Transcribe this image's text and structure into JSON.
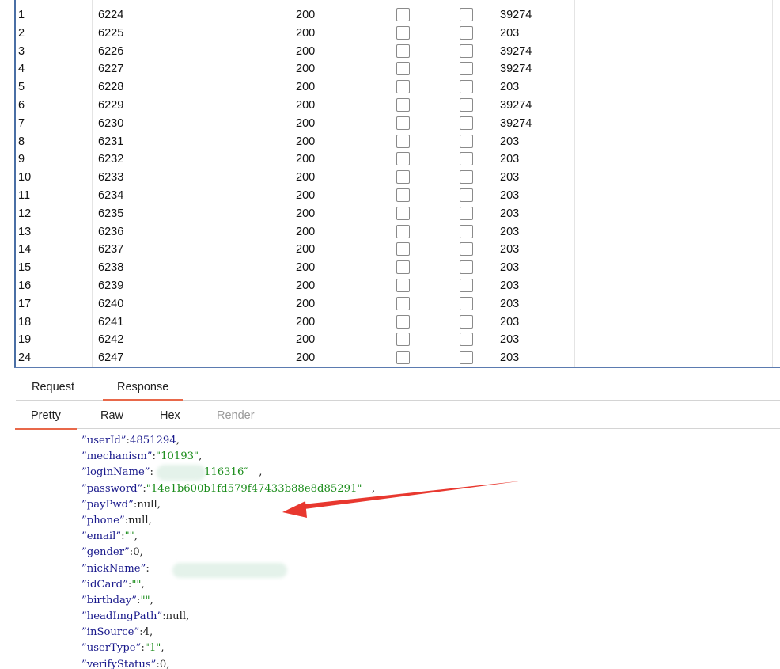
{
  "results": {
    "rows": [
      {
        "idx": "1",
        "payload": "6224",
        "status": "200",
        "length": "39274"
      },
      {
        "idx": "2",
        "payload": "6225",
        "status": "200",
        "length": "203"
      },
      {
        "idx": "3",
        "payload": "6226",
        "status": "200",
        "length": "39274"
      },
      {
        "idx": "4",
        "payload": "6227",
        "status": "200",
        "length": "39274"
      },
      {
        "idx": "5",
        "payload": "6228",
        "status": "200",
        "length": "203"
      },
      {
        "idx": "6",
        "payload": "6229",
        "status": "200",
        "length": "39274"
      },
      {
        "idx": "7",
        "payload": "6230",
        "status": "200",
        "length": "39274"
      },
      {
        "idx": "8",
        "payload": "6231",
        "status": "200",
        "length": "203"
      },
      {
        "idx": "9",
        "payload": "6232",
        "status": "200",
        "length": "203"
      },
      {
        "idx": "10",
        "payload": "6233",
        "status": "200",
        "length": "203"
      },
      {
        "idx": "11",
        "payload": "6234",
        "status": "200",
        "length": "203"
      },
      {
        "idx": "12",
        "payload": "6235",
        "status": "200",
        "length": "203"
      },
      {
        "idx": "13",
        "payload": "6236",
        "status": "200",
        "length": "203"
      },
      {
        "idx": "14",
        "payload": "6237",
        "status": "200",
        "length": "203"
      },
      {
        "idx": "15",
        "payload": "6238",
        "status": "200",
        "length": "203"
      },
      {
        "idx": "16",
        "payload": "6239",
        "status": "200",
        "length": "203"
      },
      {
        "idx": "17",
        "payload": "6240",
        "status": "200",
        "length": "203"
      },
      {
        "idx": "18",
        "payload": "6241",
        "status": "200",
        "length": "203"
      },
      {
        "idx": "19",
        "payload": "6242",
        "status": "200",
        "length": "203"
      },
      {
        "idx": "24",
        "payload": "6247",
        "status": "200",
        "length": "203"
      }
    ]
  },
  "tabs": {
    "request": "Request",
    "response": "Response"
  },
  "subtabs": {
    "pretty": "Pretty",
    "raw": "Raw",
    "hex": "Hex",
    "render": "Render"
  },
  "response_body": {
    "lines": [
      {
        "key": "userId",
        "sep": ":",
        "value": "4851294",
        "vtype": "num",
        "tail": ","
      },
      {
        "key": "mechanism",
        "sep": ":",
        "value": "\"10193\"",
        "vtype": "str",
        "tail": ","
      },
      {
        "key": "loginName",
        "sep": ":",
        "value": "\"116316\"",
        "vtype": "str",
        "tail": " ,",
        "redacted": true
      },
      {
        "key": "password",
        "sep": ":",
        "value": "\"14e1b600b1fd579f47433b88e8d85291\"",
        "vtype": "str",
        "tail": "   ,"
      },
      {
        "key": "payPwd",
        "sep": ":",
        "value": "null",
        "vtype": "plain",
        "tail": ","
      },
      {
        "key": "phone",
        "sep": ":",
        "value": "null",
        "vtype": "plain",
        "tail": ","
      },
      {
        "key": "email",
        "sep": ":",
        "value": "\"\"",
        "vtype": "str",
        "tail": ","
      },
      {
        "key": "gender",
        "sep": ":",
        "value": "0",
        "vtype": "plain",
        "tail": ","
      },
      {
        "key": "nickName",
        "sep": ":",
        "value": "",
        "vtype": "str",
        "tail": "",
        "redacted": true
      },
      {
        "key": "idCard",
        "sep": ":",
        "value": "\"\"",
        "vtype": "str",
        "tail": ","
      },
      {
        "key": "birthday",
        "sep": ":",
        "value": "\"\"",
        "vtype": "str",
        "tail": ","
      },
      {
        "key": "headImgPath",
        "sep": ":",
        "value": "null",
        "vtype": "plain",
        "tail": ","
      },
      {
        "key": "inSource",
        "sep": ":",
        "value": "4",
        "vtype": "plain",
        "tail": ","
      },
      {
        "key": "userType",
        "sep": ":",
        "value": "\"1\"",
        "vtype": "str",
        "tail": ","
      },
      {
        "key": "verifyStatus",
        "sep": ":",
        "value": "0",
        "vtype": "plain",
        "tail": ","
      }
    ]
  },
  "colors": {
    "accent": "#e8684a",
    "table_border": "#4a6fa5",
    "json_key": "#1a1a8c",
    "json_string": "#1a8c1a",
    "annotation_arrow": "#e8382f"
  }
}
